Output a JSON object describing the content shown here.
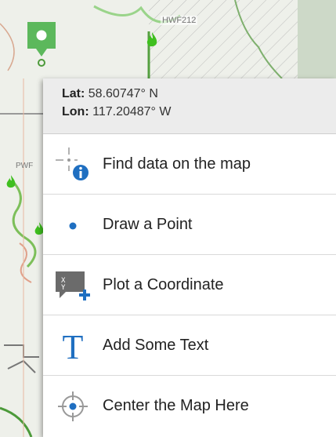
{
  "map": {
    "road_label_top": "HWF212",
    "road_label_left": "PWF"
  },
  "coords": {
    "lat_label": "Lat:",
    "lat_value": "58.60747° N",
    "lon_label": "Lon:",
    "lon_value": "117.20487° W"
  },
  "menu": {
    "items": [
      {
        "label": "Find data on the map",
        "icon": "find-data-icon"
      },
      {
        "label": "Draw a Point",
        "icon": "point-icon"
      },
      {
        "label": "Plot a Coordinate",
        "icon": "plot-coordinate-icon"
      },
      {
        "label": "Add Some Text",
        "icon": "text-icon"
      },
      {
        "label": "Center the Map Here",
        "icon": "center-crosshair-icon"
      }
    ]
  },
  "colors": {
    "accent": "#1f6fc1",
    "marker": "#5cb85c",
    "fire": "#3fbf1f"
  }
}
